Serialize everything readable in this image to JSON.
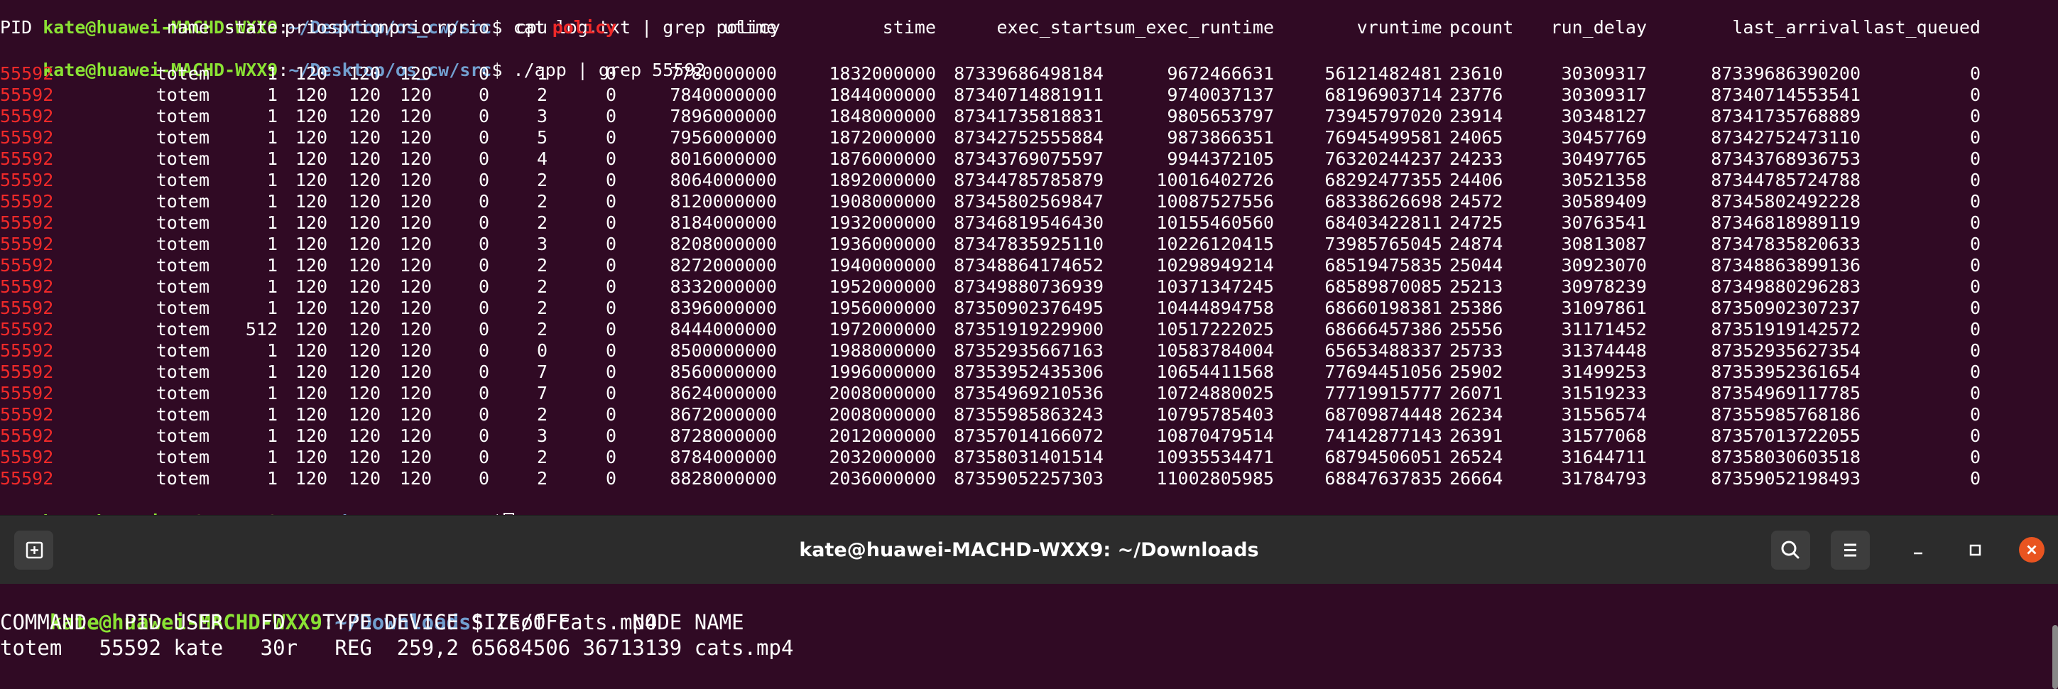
{
  "top_terminal": {
    "prompt_user": "kate@huawei-MACHD-WXX9",
    "prompt_path": "~/Desktop/os_cw/src",
    "prompt_symbol": "$",
    "command1": " cat log.txt | grep policy",
    "command2": " ./app | grep 55592",
    "headers": [
      "PID",
      "name",
      "state",
      "prio",
      "sprio",
      "nprio",
      "rprio",
      "cpu",
      "policy",
      "utime",
      "stime",
      "exec_start",
      "sum_exec_runtime",
      "vruntime",
      "pcount",
      "run_delay",
      "last_arrival",
      "last_queued"
    ],
    "rows": [
      [
        "55592",
        "totem",
        "1",
        "120",
        "120",
        "120",
        "0",
        "1",
        "0",
        "7780000000",
        "1832000000",
        "87339686498184",
        "9672466631",
        "56121482481",
        "23610",
        "30309317",
        "87339686390200",
        "0"
      ],
      [
        "55592",
        "totem",
        "1",
        "120",
        "120",
        "120",
        "0",
        "2",
        "0",
        "7840000000",
        "1844000000",
        "87340714881911",
        "9740037137",
        "68196903714",
        "23776",
        "30309317",
        "87340714553541",
        "0"
      ],
      [
        "55592",
        "totem",
        "1",
        "120",
        "120",
        "120",
        "0",
        "3",
        "0",
        "7896000000",
        "1848000000",
        "87341735818831",
        "9805653797",
        "73945797020",
        "23914",
        "30348127",
        "87341735768889",
        "0"
      ],
      [
        "55592",
        "totem",
        "1",
        "120",
        "120",
        "120",
        "0",
        "5",
        "0",
        "7956000000",
        "1872000000",
        "87342752555884",
        "9873866351",
        "76945499581",
        "24065",
        "30457769",
        "87342752473110",
        "0"
      ],
      [
        "55592",
        "totem",
        "1",
        "120",
        "120",
        "120",
        "0",
        "4",
        "0",
        "8016000000",
        "1876000000",
        "87343769075597",
        "9944372105",
        "76320244237",
        "24233",
        "30497765",
        "87343768936753",
        "0"
      ],
      [
        "55592",
        "totem",
        "1",
        "120",
        "120",
        "120",
        "0",
        "2",
        "0",
        "8064000000",
        "1892000000",
        "87344785785879",
        "10016402726",
        "68292477355",
        "24406",
        "30521358",
        "87344785724788",
        "0"
      ],
      [
        "55592",
        "totem",
        "1",
        "120",
        "120",
        "120",
        "0",
        "2",
        "0",
        "8120000000",
        "1908000000",
        "87345802569847",
        "10087527556",
        "68338626698",
        "24572",
        "30589409",
        "87345802492228",
        "0"
      ],
      [
        "55592",
        "totem",
        "1",
        "120",
        "120",
        "120",
        "0",
        "2",
        "0",
        "8184000000",
        "1932000000",
        "87346819546430",
        "10155460560",
        "68403422811",
        "24725",
        "30763541",
        "87346818989119",
        "0"
      ],
      [
        "55592",
        "totem",
        "1",
        "120",
        "120",
        "120",
        "0",
        "3",
        "0",
        "8208000000",
        "1936000000",
        "87347835925110",
        "10226120415",
        "73985765045",
        "24874",
        "30813087",
        "87347835820633",
        "0"
      ],
      [
        "55592",
        "totem",
        "1",
        "120",
        "120",
        "120",
        "0",
        "2",
        "0",
        "8272000000",
        "1940000000",
        "87348864174652",
        "10298949214",
        "68519475835",
        "25044",
        "30923070",
        "87348863899136",
        "0"
      ],
      [
        "55592",
        "totem",
        "1",
        "120",
        "120",
        "120",
        "0",
        "2",
        "0",
        "8332000000",
        "1952000000",
        "87349880736939",
        "10371347245",
        "68589870085",
        "25213",
        "30978239",
        "87349880296283",
        "0"
      ],
      [
        "55592",
        "totem",
        "1",
        "120",
        "120",
        "120",
        "0",
        "2",
        "0",
        "8396000000",
        "1956000000",
        "87350902376495",
        "10444894758",
        "68660198381",
        "25386",
        "31097861",
        "87350902307237",
        "0"
      ],
      [
        "55592",
        "totem",
        "512",
        "120",
        "120",
        "120",
        "0",
        "2",
        "0",
        "8444000000",
        "1972000000",
        "87351919229900",
        "10517222025",
        "68666457386",
        "25556",
        "31171452",
        "87351919142572",
        "0"
      ],
      [
        "55592",
        "totem",
        "1",
        "120",
        "120",
        "120",
        "0",
        "0",
        "0",
        "8500000000",
        "1988000000",
        "87352935667163",
        "10583784004",
        "65653488337",
        "25733",
        "31374448",
        "87352935627354",
        "0"
      ],
      [
        "55592",
        "totem",
        "1",
        "120",
        "120",
        "120",
        "0",
        "7",
        "0",
        "8560000000",
        "1996000000",
        "87353952435306",
        "10654411568",
        "77694451056",
        "25902",
        "31499253",
        "87353952361654",
        "0"
      ],
      [
        "55592",
        "totem",
        "1",
        "120",
        "120",
        "120",
        "0",
        "7",
        "0",
        "8624000000",
        "2008000000",
        "87354969210536",
        "10724880025",
        "77719915777",
        "26071",
        "31519233",
        "87354969117785",
        "0"
      ],
      [
        "55592",
        "totem",
        "1",
        "120",
        "120",
        "120",
        "0",
        "2",
        "0",
        "8672000000",
        "2008000000",
        "87355985863243",
        "10795785403",
        "68709874448",
        "26234",
        "31556574",
        "87355985768186",
        "0"
      ],
      [
        "55592",
        "totem",
        "1",
        "120",
        "120",
        "120",
        "0",
        "3",
        "0",
        "8728000000",
        "2012000000",
        "87357014166072",
        "10870479514",
        "74142877143",
        "26391",
        "31577068",
        "87357013722055",
        "0"
      ],
      [
        "55592",
        "totem",
        "1",
        "120",
        "120",
        "120",
        "0",
        "2",
        "0",
        "8784000000",
        "2032000000",
        "87358031401514",
        "10935534471",
        "68794506051",
        "26524",
        "31644711",
        "87358030603518",
        "0"
      ],
      [
        "55592",
        "totem",
        "1",
        "120",
        "120",
        "120",
        "0",
        "2",
        "0",
        "8828000000",
        "2036000000",
        "87359052257303",
        "11002805985",
        "68847637835",
        "26664",
        "31784793",
        "87359052198493",
        "0"
      ]
    ]
  },
  "window": {
    "title": "kate@huawei-MACHD-WXX9: ~/Downloads",
    "new_tab_icon": "new-tab-icon",
    "search_icon": "search-icon",
    "menu_icon": "hamburger-menu-icon",
    "minimize_icon": "minimize-icon",
    "maximize_icon": "maximize-icon",
    "close_icon": "close-icon",
    "close_color": "#e95420"
  },
  "bottom_terminal": {
    "prompt_user": "kate@huawei-MACHD-WXX9",
    "prompt_path": "~/Downloads",
    "prompt_symbol": "$",
    "command": " lsof cats.mp4",
    "output_header": "COMMAND   PID USER   FD   TYPE DEVICE SIZE/OFF     NODE NAME",
    "output_row": "totem   55592 kate   30r   REG  259,2 65684506 36713139 cats.mp4"
  },
  "colors": {
    "background": "#300a24",
    "prompt_user": "#8ae234",
    "prompt_path": "#729fcf",
    "highlight": "#ef2929",
    "titlebar": "#2c2c2c"
  }
}
